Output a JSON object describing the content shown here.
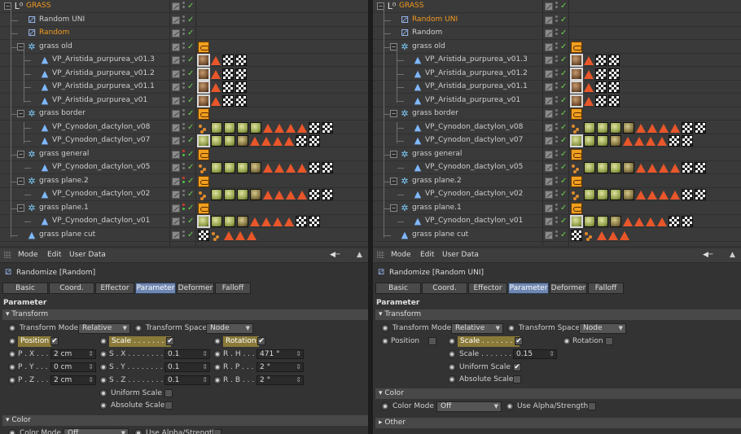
{
  "panels": [
    {
      "id": "left",
      "objects": [
        {
          "name": "GRASS",
          "color": "orange",
          "icon": "null-object-icon",
          "indent": 0,
          "expander": "−",
          "tags": []
        },
        {
          "name": "Random UNI",
          "color": "normal",
          "icon": "random-effector-icon",
          "indent": 1,
          "tags": []
        },
        {
          "name": "Random",
          "color": "orange",
          "icon": "random-effector-icon",
          "indent": 1,
          "tags": []
        },
        {
          "name": "grass old",
          "color": "normal",
          "icon": "cloner-icon",
          "indent": 1,
          "expander": "−",
          "tags": [
            "spl"
          ]
        },
        {
          "name": "VP_Aristida_purpurea_v01.3",
          "color": "normal",
          "icon": "polygon-object-icon",
          "indent": 2,
          "tags": [
            "matb",
            "tri",
            "tex",
            "tex"
          ]
        },
        {
          "name": "VP_Aristida_purpurea_v01.2",
          "color": "normal",
          "icon": "polygon-object-icon",
          "indent": 2,
          "tags": [
            "matb",
            "tri",
            "tex",
            "tex"
          ]
        },
        {
          "name": "VP_Aristida_purpurea_v01.1",
          "color": "normal",
          "icon": "polygon-object-icon",
          "indent": 2,
          "tags": [
            "matb",
            "tri",
            "tex",
            "tex"
          ]
        },
        {
          "name": "VP_Aristida_purpurea_v01",
          "color": "normal",
          "icon": "polygon-object-icon",
          "indent": 2,
          "tags": [
            "matb",
            "tri",
            "tex",
            "tex"
          ]
        },
        {
          "name": "grass border",
          "color": "normal",
          "icon": "cloner-icon",
          "indent": 1,
          "expander": "−",
          "tags": [
            "spl"
          ]
        },
        {
          "name": "VP_Cynodon_dactylon_v08",
          "color": "normal",
          "icon": "polygon-object-icon",
          "indent": 2,
          "tags": [
            "dots",
            "matg",
            "matg",
            "matg",
            "matg",
            "tri",
            "tri",
            "tri",
            "tri",
            "tex",
            "tex"
          ]
        },
        {
          "name": "VP_Cynodon_dactylon_v07",
          "color": "normal",
          "icon": "polygon-object-icon",
          "indent": 2,
          "tags": [
            "matg",
            "matg",
            "matg",
            "mat",
            "tri",
            "tri",
            "tri",
            "tri",
            "tex",
            "tex"
          ]
        },
        {
          "name": "grass general",
          "color": "normal",
          "icon": "cloner-icon",
          "indent": 1,
          "expander": "−",
          "tags": [
            "spl"
          ],
          "redDot": true
        },
        {
          "name": "VP_Cynodon_dactylon_v05",
          "color": "normal",
          "icon": "polygon-object-icon",
          "indent": 2,
          "tags": [
            "dots",
            "matg",
            "matg",
            "matg",
            "mat",
            "tri",
            "tri",
            "tri",
            "tri",
            "tex",
            "tex"
          ]
        },
        {
          "name": "grass plane.2",
          "color": "normal",
          "icon": "cloner-icon",
          "indent": 1,
          "expander": "−",
          "tags": [
            "spl"
          ],
          "redDot": true
        },
        {
          "name": "VP_Cynodon_dactylon_v02",
          "color": "normal",
          "icon": "polygon-object-icon",
          "indent": 2,
          "tags": [
            "dots",
            "matg",
            "matg",
            "matg",
            "mat",
            "tri",
            "tri",
            "tri",
            "tri",
            "tex",
            "tex"
          ]
        },
        {
          "name": "grass plane.1",
          "color": "normal",
          "icon": "cloner-icon",
          "indent": 1,
          "expander": "−",
          "tags": [
            "spl"
          ],
          "redDot": true
        },
        {
          "name": "VP_Cynodon_dactylon_v01",
          "color": "normal",
          "icon": "polygon-object-icon",
          "indent": 2,
          "tags": [
            "matg",
            "matg",
            "matg",
            "mat",
            "tri",
            "tri",
            "tri",
            "tri",
            "tex",
            "tex"
          ]
        },
        {
          "name": "grass plane cut",
          "color": "normal",
          "icon": "polygon-object-icon",
          "indent": 1,
          "tags": [
            "tex",
            "dots",
            "tri",
            "tri",
            "tri"
          ]
        }
      ],
      "menu": {
        "mode": "Mode",
        "edit": "Edit",
        "userdata": "User Data"
      },
      "title": "Randomize [Random]",
      "tabs": [
        {
          "label": "Basic"
        },
        {
          "label": "Coord."
        },
        {
          "label": "Effector"
        },
        {
          "label": "Parameter",
          "active": true
        },
        {
          "label": "Deformer"
        },
        {
          "label": "Falloff"
        }
      ],
      "section": "Parameter",
      "transform_header": "Transform",
      "transform_mode_label": "Transform Mode",
      "transform_mode_value": "Relative",
      "transform_space_label": "Transform Space",
      "transform_space_value": "Node",
      "position_label": "Position",
      "position_on": true,
      "scale_label": "Scale . . . . . . . .",
      "scale_on": true,
      "rotation_label": "Rotation",
      "rotation_on": true,
      "px_label": "P . X . . . . .",
      "px": "2 cm",
      "py_label": "P . Y . . . . .",
      "py": "0 cm",
      "pz_label": "P . Z . . . . .",
      "pz": "2 cm",
      "sx_label": "S . X . . . . . . . .",
      "sx": "0.1",
      "sy_label": "S . Y . . . . . . . .",
      "sy": "0.1",
      "sz_label": "S . Z . . . . . . . .",
      "sz": "0.1",
      "rh_label": "R . H . . . . .",
      "rh": "471 °",
      "rp_label": "R . P . . . . .",
      "rp": "2 °",
      "rb_label": "R . B . . . . .",
      "rb": "2 °",
      "uniform_label": "Uniform Scale",
      "absolute_label": "Absolute Scale",
      "color_header": "Color",
      "color_mode_label": "Color Mode",
      "color_mode_value": "Off",
      "alpha_label": "Use Alpha/Strength"
    },
    {
      "id": "right",
      "objects": [
        {
          "name": "GRASS",
          "color": "orange",
          "icon": "null-object-icon",
          "indent": 0,
          "expander": "−",
          "tags": []
        },
        {
          "name": "Random UNI",
          "color": "orange",
          "icon": "random-effector-icon",
          "indent": 1,
          "tags": []
        },
        {
          "name": "Random",
          "color": "normal",
          "icon": "random-effector-icon",
          "indent": 1,
          "tags": []
        },
        {
          "name": "grass old",
          "color": "normal",
          "icon": "cloner-icon",
          "indent": 1,
          "expander": "−",
          "tags": [
            "spl"
          ]
        },
        {
          "name": "VP_Aristida_purpurea_v01.3",
          "color": "normal",
          "icon": "polygon-object-icon",
          "indent": 2,
          "tags": [
            "matb",
            "tri",
            "tex",
            "tex"
          ]
        },
        {
          "name": "VP_Aristida_purpurea_v01.2",
          "color": "normal",
          "icon": "polygon-object-icon",
          "indent": 2,
          "tags": [
            "matb",
            "tri",
            "tex",
            "tex"
          ]
        },
        {
          "name": "VP_Aristida_purpurea_v01.1",
          "color": "normal",
          "icon": "polygon-object-icon",
          "indent": 2,
          "tags": [
            "matb",
            "tri",
            "tex",
            "tex"
          ]
        },
        {
          "name": "VP_Aristida_purpurea_v01",
          "color": "normal",
          "icon": "polygon-object-icon",
          "indent": 2,
          "tags": [
            "matb",
            "tri",
            "tex",
            "tex"
          ]
        },
        {
          "name": "grass border",
          "color": "normal",
          "icon": "cloner-icon",
          "indent": 1,
          "expander": "−",
          "tags": [
            "spl"
          ]
        },
        {
          "name": "VP_Cynodon_dactylon_v08",
          "color": "normal",
          "icon": "polygon-object-icon",
          "indent": 2,
          "tags": [
            "dots",
            "matg",
            "matg",
            "matg",
            "mat",
            "tri",
            "tri",
            "tri",
            "tri",
            "tex",
            "tex"
          ]
        },
        {
          "name": "VP_Cynodon_dactylon_v07",
          "color": "normal",
          "icon": "polygon-object-icon",
          "indent": 2,
          "tags": [
            "matg",
            "matg",
            "matg",
            "mat",
            "tri",
            "tri",
            "tri",
            "tri",
            "tex",
            "tex"
          ]
        },
        {
          "name": "grass general",
          "color": "normal",
          "icon": "cloner-icon",
          "indent": 1,
          "expander": "−",
          "tags": [
            "spl"
          ]
        },
        {
          "name": "VP_Cynodon_dactylon_v05",
          "color": "normal",
          "icon": "polygon-object-icon",
          "indent": 2,
          "tags": [
            "dots",
            "matg",
            "matg",
            "matg",
            "mat",
            "tri",
            "tri",
            "tri",
            "tri",
            "tex",
            "tex"
          ]
        },
        {
          "name": "grass plane.2",
          "color": "normal",
          "icon": "cloner-icon",
          "indent": 1,
          "expander": "−",
          "tags": [
            "spl"
          ]
        },
        {
          "name": "VP_Cynodon_dactylon_v02",
          "color": "normal",
          "icon": "polygon-object-icon",
          "indent": 2,
          "tags": [
            "dots",
            "matg",
            "matg",
            "matg",
            "mat",
            "tri",
            "tri",
            "tri",
            "tri",
            "tex",
            "tex"
          ]
        },
        {
          "name": "grass plane.1",
          "color": "normal",
          "icon": "cloner-icon",
          "indent": 1,
          "expander": "−",
          "tags": [
            "spl"
          ]
        },
        {
          "name": "VP_Cynodon_dactylon_v01",
          "color": "normal",
          "icon": "polygon-object-icon",
          "indent": 2,
          "tags": [
            "matg",
            "matg",
            "matg",
            "mat",
            "tri",
            "tri",
            "tri",
            "tri",
            "tex",
            "tex"
          ]
        },
        {
          "name": "grass plane cut",
          "color": "normal",
          "icon": "polygon-object-icon",
          "indent": 1,
          "tags": [
            "tex",
            "dots",
            "tri",
            "tri",
            "tri"
          ]
        }
      ],
      "menu": {
        "mode": "Mode",
        "edit": "Edit",
        "userdata": "User Data"
      },
      "title": "Randomize [Random UNI]",
      "tabs": [
        {
          "label": "Basic"
        },
        {
          "label": "Coord."
        },
        {
          "label": "Effector"
        },
        {
          "label": "Parameter",
          "active": true
        },
        {
          "label": "Deformer"
        },
        {
          "label": "Falloff"
        }
      ],
      "section": "Parameter",
      "transform_header": "Transform",
      "transform_mode_label": "Transform Mode",
      "transform_mode_value": "Relative",
      "transform_space_label": "Transform Space",
      "transform_space_value": "Node",
      "position_label": "Position",
      "position_on": false,
      "scale_label": "Scale . . . . . . . .",
      "scale_on": true,
      "rotation_label": "Rotation",
      "rotation_on": false,
      "scale_value_label": "Scale . . . . . . . .",
      "scale_value": "0.15",
      "uniform_label": "Uniform Scale",
      "uniform_on": true,
      "absolute_label": "Absolute Scale",
      "color_header": "Color",
      "color_mode_label": "Color Mode",
      "color_mode_value": "Off",
      "alpha_label": "Use Alpha/Strength",
      "other_header": "Other"
    }
  ],
  "colors": {
    "orange": "#f39a1f",
    "accent_tab": "#6f87b0",
    "check": "#6bd24f"
  }
}
